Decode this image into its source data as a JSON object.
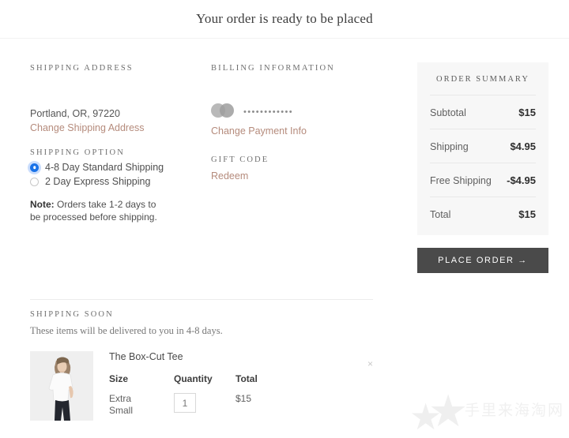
{
  "header": {
    "title": "Your order is ready to be placed"
  },
  "shipping_address": {
    "heading": "SHIPPING ADDRESS",
    "line": "Portland, OR, 97220",
    "change_link": "Change Shipping Address"
  },
  "shipping_option": {
    "heading": "SHIPPING OPTION",
    "options": [
      {
        "label": "4-8 Day Standard Shipping",
        "selected": true
      },
      {
        "label": "2 Day Express Shipping",
        "selected": false
      }
    ],
    "note_label": "Note:",
    "note_text": " Orders take 1-2 days to be processed before shipping."
  },
  "billing": {
    "heading": "BILLING INFORMATION",
    "card_brand_icon": "mastercard-icon",
    "card_mask": "••••••••••••",
    "change_link": "Change Payment Info"
  },
  "gift_code": {
    "heading": "GIFT CODE",
    "redeem_link": "Redeem"
  },
  "order_summary": {
    "title": "ORDER SUMMARY",
    "rows": [
      {
        "label": "Subtotal",
        "value": "$15"
      },
      {
        "label": "Shipping",
        "value": "$4.95"
      },
      {
        "label": "Free Shipping",
        "value": "-$4.95"
      },
      {
        "label": "Total",
        "value": "$15"
      }
    ],
    "place_order_label": "PLACE ORDER →"
  },
  "shipping_soon": {
    "heading": "SHIPPING SOON",
    "subtitle": "These items will be delivered to you in 4-8 days.",
    "item": {
      "name": "The Box-Cut Tee",
      "thumb_alt": "model-wearing-white-tee",
      "size_head": "Size",
      "size_value": "Extra Small",
      "qty_head": "Quantity",
      "qty_value": "1",
      "total_head": "Total",
      "total_value": "$15",
      "remove_label": "×"
    }
  },
  "watermark": {
    "text": "手里来海淘网",
    "star": "★"
  },
  "colors": {
    "link": "#b58b7c",
    "radio_selected": "#1a73e8",
    "button": "#4a4a4a",
    "panel_bg": "#f7f7f7"
  }
}
